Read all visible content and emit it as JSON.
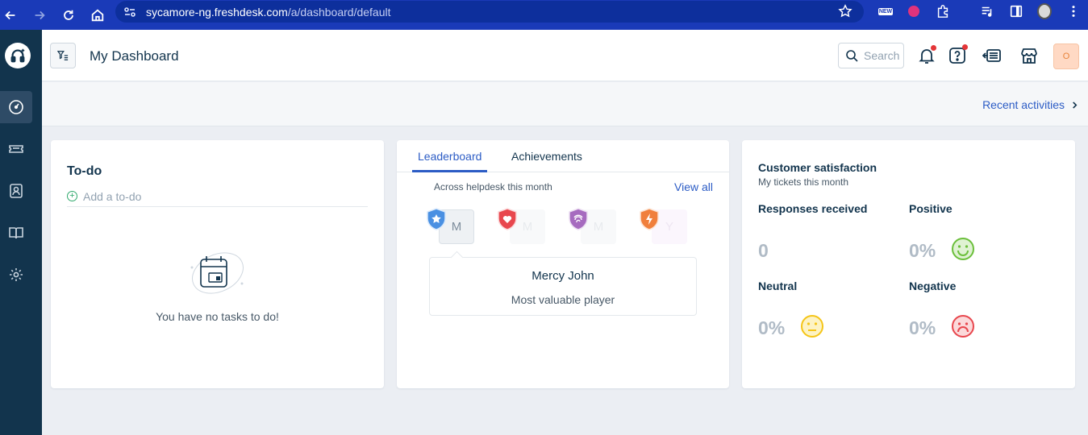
{
  "browser": {
    "url_host": "sycamore-ng.freshdesk.com",
    "url_path": "/a/dashboard/default",
    "ext_new_label": "NEW"
  },
  "header": {
    "title": "My Dashboard",
    "search_label": "Search",
    "avatar_initial": "O"
  },
  "subbar": {
    "recent_label": "Recent activities"
  },
  "todo": {
    "title": "To-do",
    "add_placeholder": "Add a to-do",
    "empty_text": "You have no tasks to do!"
  },
  "leaderboard": {
    "tabs": [
      "Leaderboard",
      "Achievements"
    ],
    "subtitle": "Across helpdesk this month",
    "view_all": "View all",
    "badges": [
      {
        "initial": "M",
        "color": "#4a90e2"
      },
      {
        "initial": "M",
        "color": "#e8474e"
      },
      {
        "initial": "M",
        "color": "#a66bbf"
      },
      {
        "initial": "Y",
        "color": "#f07f3c"
      }
    ],
    "mvp_name": "Mercy John",
    "mvp_role": "Most valuable player"
  },
  "csat": {
    "title": "Customer satisfaction",
    "subtitle": "My tickets this month",
    "responses_label": "Responses received",
    "responses_value": "0",
    "positive_label": "Positive",
    "positive_value": "0%",
    "neutral_label": "Neutral",
    "neutral_value": "0%",
    "negative_label": "Negative",
    "negative_value": "0%"
  },
  "colors": {
    "accent": "#2c5cc5",
    "sidebar": "#12344d",
    "positive": "#6bbf3b",
    "neutral": "#f5c518",
    "negative": "#e8474e"
  }
}
